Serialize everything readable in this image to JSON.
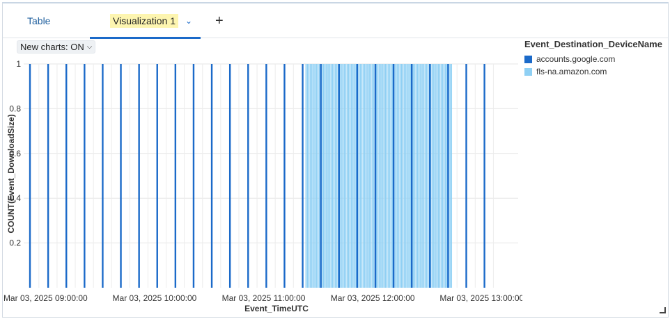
{
  "tabs": {
    "table_label": "Table",
    "viz_label": "Visualization 1",
    "add_label": "+"
  },
  "toolbar": {
    "new_charts_label": "New charts: ON"
  },
  "legend": {
    "title": "Event_Destination_DeviceName",
    "items": [
      {
        "label": "accounts.google.com",
        "color": "#1b6ac9"
      },
      {
        "label": "fls-na.amazon.com",
        "color": "#8fd0f4"
      }
    ]
  },
  "colors": {
    "accent": "#1b6ac9",
    "series1": "#1b6ac9",
    "series2": "#8fd0f4",
    "grid": "#e6e6e6"
  },
  "chart_data": {
    "type": "bar",
    "title": "",
    "xlabel": "Event_TimeUTC",
    "ylabel": "COUNT(Event_DownloadSize)",
    "ylim": [
      0,
      1
    ],
    "xlim": [
      "2025-03-03 08:48",
      "2025-03-03 13:20"
    ],
    "yticks": [
      "0.2",
      "0.4",
      "0.6",
      "0.8",
      "1"
    ],
    "xticks": [
      "Mar 03, 2025 09:00:00",
      "Mar 03, 2025 10:00:00",
      "Mar 03, 2025 11:00:00",
      "Mar 03, 2025 12:00:00",
      "Mar 03, 2025 13:00:00"
    ],
    "grid": true,
    "legend_position": "top-right",
    "series": [
      {
        "name": "accounts.google.com",
        "x": [
          "2025-03-03 08:51",
          "2025-03-03 09:01",
          "2025-03-03 09:11",
          "2025-03-03 09:21",
          "2025-03-03 09:31",
          "2025-03-03 09:41",
          "2025-03-03 09:51",
          "2025-03-03 10:01",
          "2025-03-03 10:11",
          "2025-03-03 10:21",
          "2025-03-03 10:31",
          "2025-03-03 10:41",
          "2025-03-03 10:51",
          "2025-03-03 11:01",
          "2025-03-03 11:11",
          "2025-03-03 11:21",
          "2025-03-03 11:31",
          "2025-03-03 11:41",
          "2025-03-03 11:51",
          "2025-03-03 12:01",
          "2025-03-03 12:11",
          "2025-03-03 12:21",
          "2025-03-03 12:31",
          "2025-03-03 12:41",
          "2025-03-03 12:51",
          "2025-03-03 13:01"
        ],
        "values": [
          1,
          1,
          1,
          1,
          1,
          1,
          1,
          1,
          1,
          1,
          1,
          1,
          1,
          1,
          1,
          1,
          1,
          1,
          1,
          1,
          1,
          1,
          1,
          1,
          1,
          1
        ]
      },
      {
        "name": "fls-na.amazon.com",
        "x_range": [
          "2025-03-03 11:23",
          "2025-03-03 12:43"
        ],
        "count": 100,
        "values": [
          1
        ]
      }
    ]
  }
}
